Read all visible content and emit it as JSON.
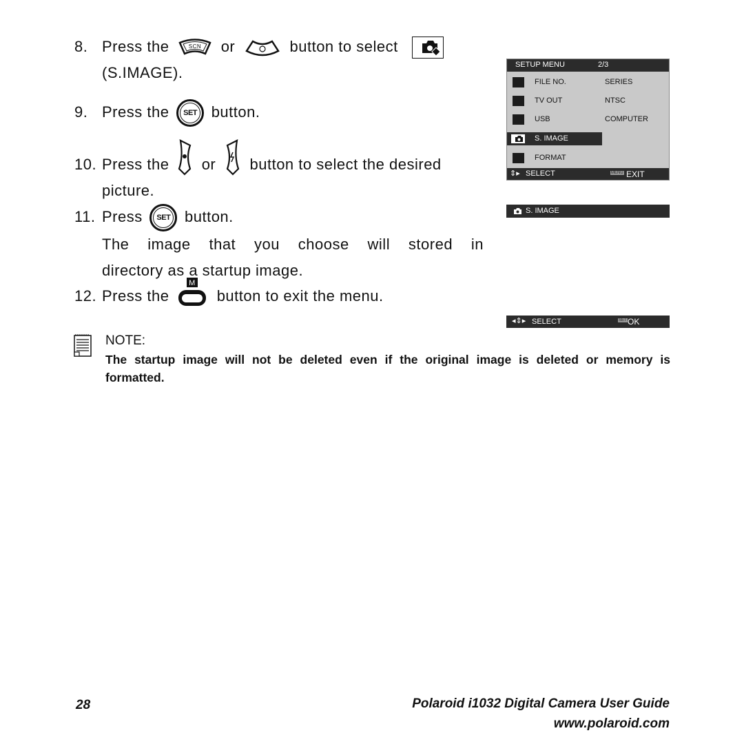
{
  "steps": {
    "step8": {
      "num": "8.",
      "pre": "Press the",
      "btn1_icon": "scn-button-icon",
      "btn1_label": "SCN",
      "or": "or",
      "btn2_icon": "self-timer-button-icon",
      "post": "button to select",
      "target_icon": "startup-image-icon",
      "line2": "(S.IMAGE)."
    },
    "step9": {
      "num": "9.",
      "pre": "Press the",
      "btn_label": "SET",
      "post": "button."
    },
    "step10": {
      "num": "10.",
      "pre": "Press the",
      "btn1_icon": "macro-button-icon",
      "or": "or",
      "btn2_icon": "flash-button-icon",
      "post": "button to select the desired",
      "line2": "picture."
    },
    "step11": {
      "num": "11.",
      "pre": "Press",
      "btn_label": "SET",
      "post": "button.",
      "line2": "The image that you choose will stored in",
      "line3": "directory as a startup image."
    },
    "step12": {
      "num": "12.",
      "pre": "Press the",
      "btn_label": "M",
      "post": "button to exit the menu."
    }
  },
  "note": {
    "title": "NOTE:",
    "text": "The startup image will not be deleted even if the original image is deleted or memory is formatted."
  },
  "setup_menu": {
    "title": "SETUP MENU",
    "page": "2/3",
    "items": [
      {
        "icon": "file-number-icon",
        "label": "FILE NO.",
        "value": "SERIES"
      },
      {
        "icon": "tv-out-icon",
        "label": "TV OUT",
        "value": "NTSC"
      },
      {
        "icon": "usb-icon",
        "label": "USB",
        "value": "COMPUTER"
      },
      {
        "icon": "startup-image-icon",
        "label": "S. IMAGE",
        "value": "",
        "selected": true
      },
      {
        "icon": "format-icon",
        "label": "FORMAT",
        "value": ""
      }
    ],
    "footer_left": "SELECT",
    "footer_right_key": "MENU",
    "footer_right": "EXIT"
  },
  "simage_screen": {
    "title": "S. IMAGE",
    "footer_left": "SELECT",
    "footer_right_key": "SET",
    "footer_right": "OK"
  },
  "footer": {
    "page_number": "28",
    "guide_title": "Polaroid i1032 Digital Camera User Guide",
    "website": "www.polaroid.com"
  }
}
